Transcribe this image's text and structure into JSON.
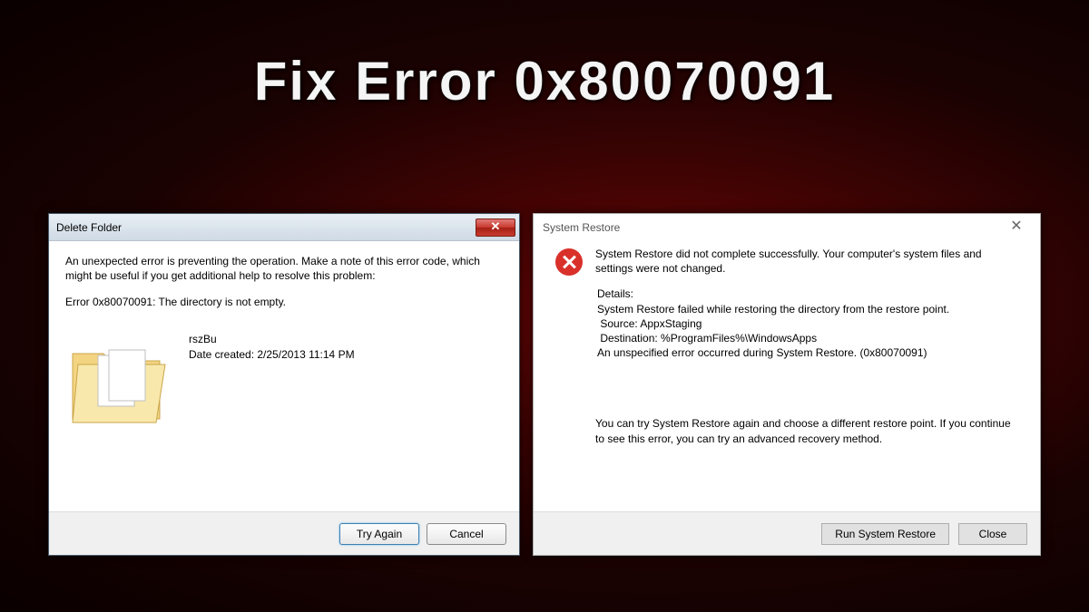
{
  "page_heading": "Fix Error 0x80070091",
  "dialog1": {
    "title": "Delete Folder",
    "close_glyph": "✕",
    "msg_intro": "An unexpected error is preventing the operation. Make a note of this error code, which might be useful if you get additional help to resolve this problem:",
    "msg_error": "Error 0x80070091: The directory is not empty.",
    "file_name": "rszBu",
    "file_date_label": "Date created: ",
    "file_date": "2/25/2013 11:14 PM",
    "btn_try": "Try Again",
    "btn_cancel": "Cancel"
  },
  "dialog2": {
    "title": "System Restore",
    "close_glyph": "✕",
    "msg_main": "System Restore did not complete successfully. Your computer's system files and settings were not changed.",
    "details_label": "Details:",
    "detail_line1": "System Restore failed while restoring the directory from the restore point.",
    "detail_source_label": "Source: ",
    "detail_source": "AppxStaging",
    "detail_dest_label": "Destination: ",
    "detail_dest": "%ProgramFiles%\\WindowsApps",
    "detail_err": "An unspecified error occurred during System Restore. (0x80070091)",
    "msg_retry": "You can try System Restore again and choose a different restore point. If you continue to see this error, you can try an advanced recovery method.",
    "btn_run": "Run System Restore",
    "btn_close": "Close"
  }
}
